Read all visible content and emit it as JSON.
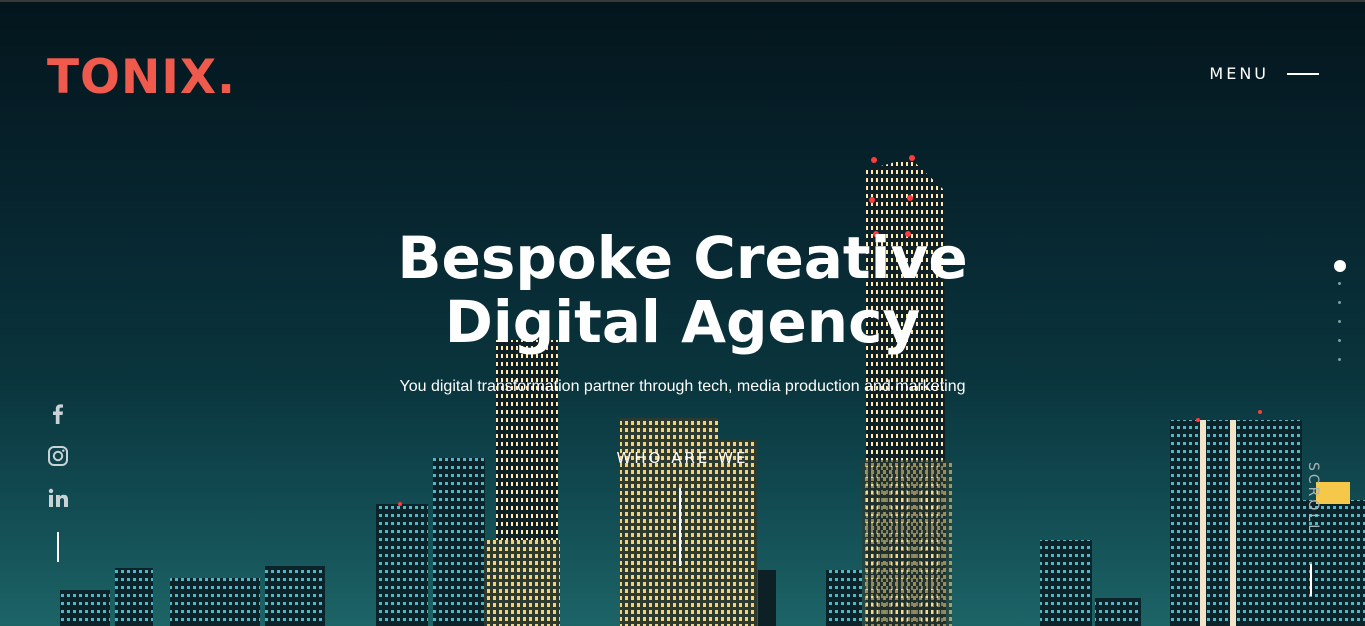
{
  "brand": {
    "name": "TONIX",
    "dot": ".",
    "accent_color": "#ef5a4c"
  },
  "header": {
    "menu_label": "MENU"
  },
  "hero": {
    "headline_line1": "Bespoke Creative",
    "headline_line2": "Digital Agency",
    "subtitle": "You digital transformation partner through tech, media production and marketing",
    "cta_label": "WHO ARE WE"
  },
  "social": {
    "items": [
      "facebook-icon",
      "instagram-icon",
      "linkedin-icon"
    ]
  },
  "slider": {
    "count": 6,
    "active_index": 0
  },
  "scroll_label": "SCROLL",
  "colors": {
    "background": "#072630",
    "text": "#ffffff"
  }
}
